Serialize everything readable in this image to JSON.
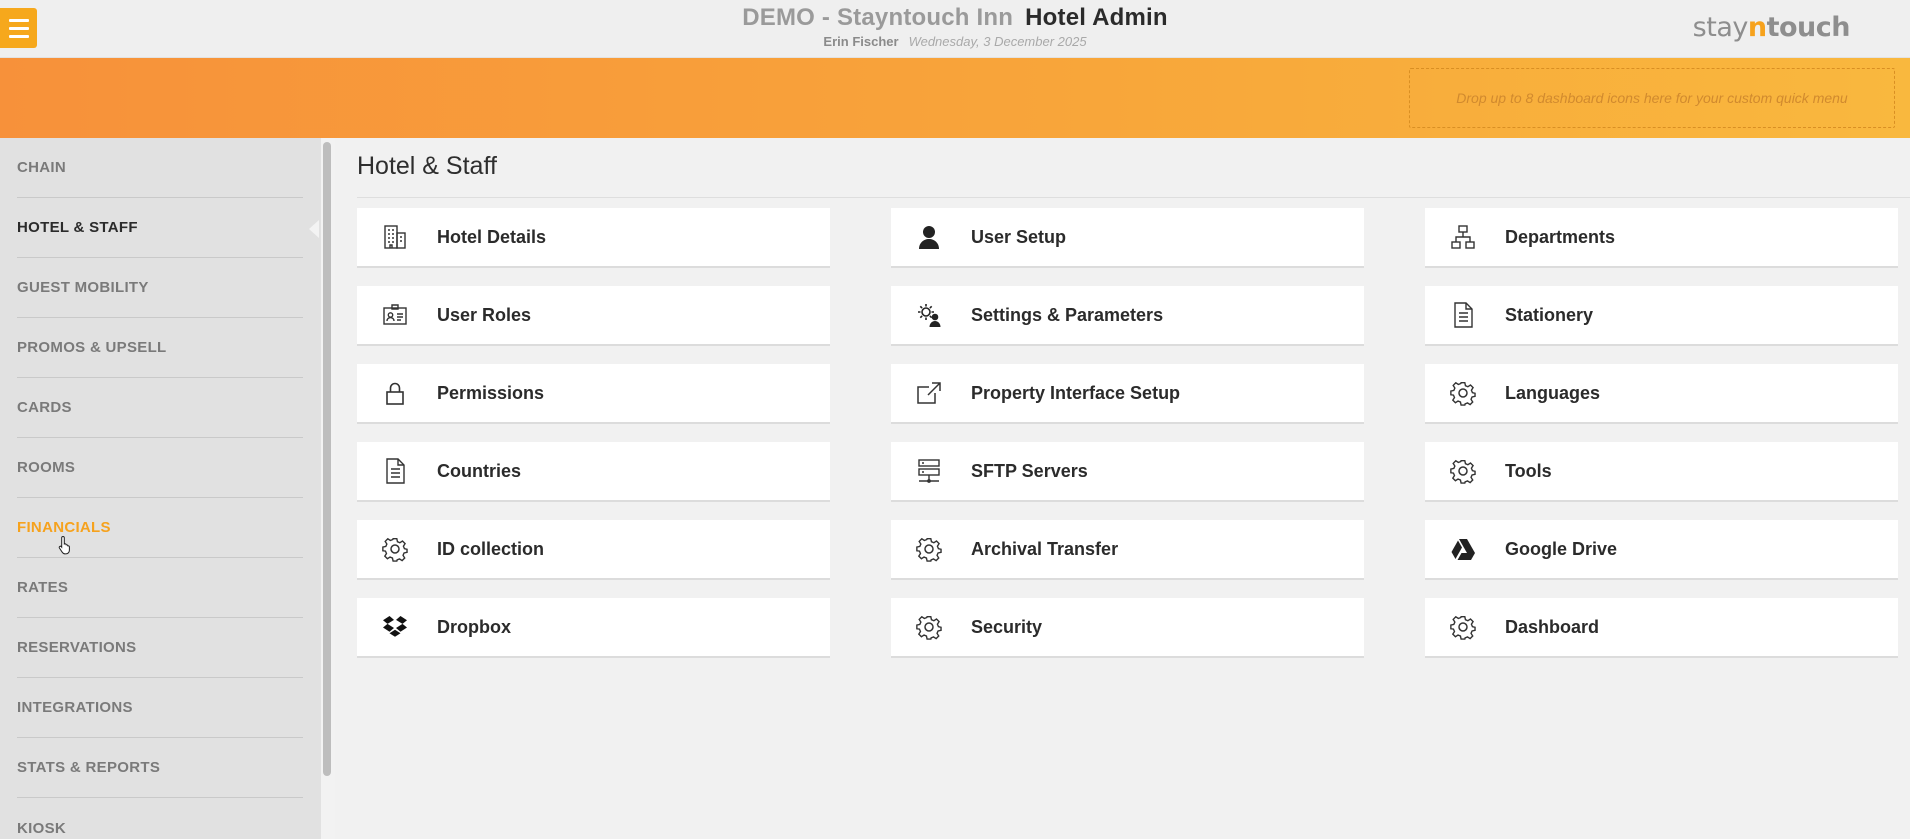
{
  "header": {
    "hotel_name": "DEMO - Stayntouch Inn",
    "app_name": "Hotel Admin",
    "user": "Erin Fischer",
    "date": "Wednesday, 3 December 2025",
    "brand_prefix": "stay",
    "brand_n": "n",
    "brand_suffix": "touch",
    "menu_icon": "hamburger-menu-icon",
    "accent_color": "#f6a81c"
  },
  "quick_menu": {
    "placeholder": "Drop up to 8 dashboard icons here for your custom quick menu"
  },
  "sidebar": {
    "items": [
      {
        "label": "CHAIN"
      },
      {
        "label": "HOTEL & STAFF",
        "state": "active"
      },
      {
        "label": "GUEST MOBILITY"
      },
      {
        "label": "PROMOS & UPSELL"
      },
      {
        "label": "CARDS"
      },
      {
        "label": "ROOMS"
      },
      {
        "label": "FINANCIALS",
        "state": "hover"
      },
      {
        "label": "RATES"
      },
      {
        "label": "RESERVATIONS"
      },
      {
        "label": "INTEGRATIONS"
      },
      {
        "label": "STATS & REPORTS"
      },
      {
        "label": "KIOSK"
      }
    ]
  },
  "main": {
    "title": "Hotel & Staff",
    "cards": [
      {
        "label": "Hotel Details",
        "icon": "building-icon"
      },
      {
        "label": "User Setup",
        "icon": "user-icon"
      },
      {
        "label": "Departments",
        "icon": "org-chart-icon"
      },
      {
        "label": "User Roles",
        "icon": "id-card-icon"
      },
      {
        "label": "Settings & Parameters",
        "icon": "user-gear-icon"
      },
      {
        "label": "Stationery",
        "icon": "document-icon"
      },
      {
        "label": "Permissions",
        "icon": "lock-icon"
      },
      {
        "label": "Property Interface Setup",
        "icon": "external-link-icon"
      },
      {
        "label": "Languages",
        "icon": "gear-icon"
      },
      {
        "label": "Countries",
        "icon": "document-icon"
      },
      {
        "label": "SFTP Servers",
        "icon": "server-icon"
      },
      {
        "label": "Tools",
        "icon": "gear-icon"
      },
      {
        "label": "ID collection",
        "icon": "gear-icon"
      },
      {
        "label": "Archival Transfer",
        "icon": "gear-icon"
      },
      {
        "label": "Google Drive",
        "icon": "google-drive-icon"
      },
      {
        "label": "Dropbox",
        "icon": "dropbox-icon"
      },
      {
        "label": "Security",
        "icon": "gear-icon"
      },
      {
        "label": "Dashboard",
        "icon": "gear-icon"
      }
    ]
  }
}
